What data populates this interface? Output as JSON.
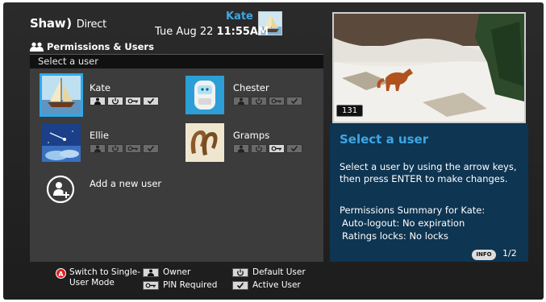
{
  "header": {
    "brand_main": "Shaw",
    "brand_paren": ")",
    "brand_sub": "Direct",
    "date": "Tue Aug 22",
    "time": "11:55AM",
    "current_user": "Kate"
  },
  "section": {
    "title": "Permissions & Users",
    "select_bar": "Select a user"
  },
  "users": [
    {
      "name": "Kate",
      "selected": true,
      "permissions": {
        "owner": true,
        "default": true,
        "pin": true,
        "active": true
      }
    },
    {
      "name": "Chester",
      "selected": false,
      "permissions": {
        "owner": false,
        "default": false,
        "pin": false,
        "active": false
      }
    },
    {
      "name": "Ellie",
      "selected": false,
      "permissions": {
        "owner": false,
        "default": false,
        "pin": false,
        "active": false
      }
    },
    {
      "name": "Gramps",
      "selected": false,
      "permissions": {
        "owner": false,
        "default": false,
        "pin": true,
        "active": false
      }
    }
  ],
  "add_user_label": "Add a new user",
  "preview": {
    "channel": "131"
  },
  "info": {
    "title": "Select a user",
    "body": "Select a user by using the arrow keys, then press ENTER to make changes.",
    "summary_title": "Permissions Summary for Kate:",
    "auto_logout": "Auto-logout: No expiration",
    "ratings_locks": "Ratings locks: No locks",
    "info_button": "INFO",
    "page": "1/2"
  },
  "legend": {
    "a_button": "A",
    "switch_mode": "Switch to Single-User Mode",
    "owner": "Owner",
    "pin_required": "PIN Required",
    "default_user": "Default User",
    "active_user": "Active User"
  },
  "colors": {
    "accent": "#3ea7e6",
    "info_panel": "#0e3552",
    "list_panel": "#3c3c3c",
    "a_button": "#dd2222"
  }
}
